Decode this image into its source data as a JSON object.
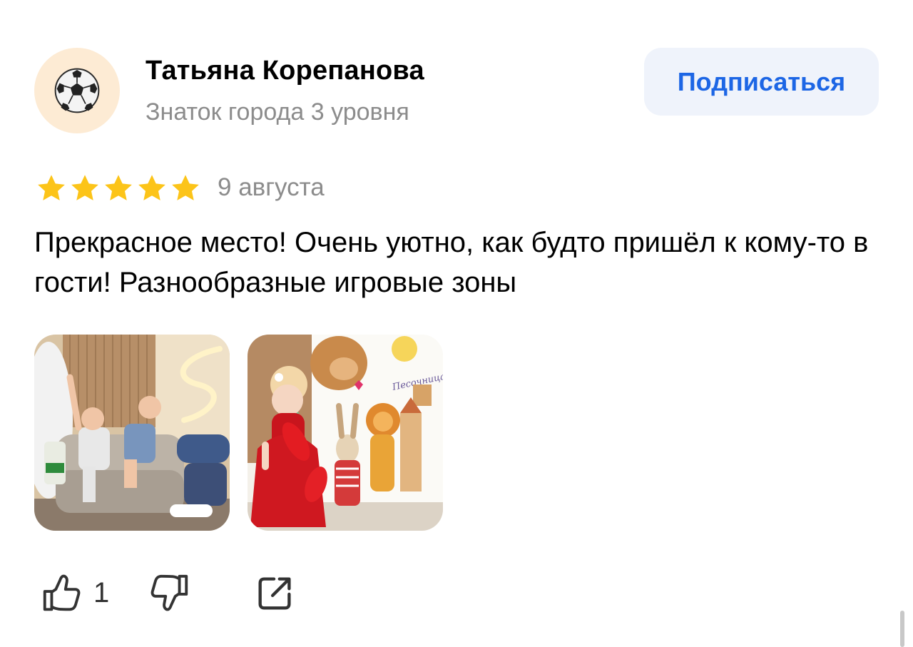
{
  "author": {
    "name": "Татьяна Корепанова",
    "level": "Знаток города 3 уровня",
    "avatar_icon": "soccer-ball-icon"
  },
  "subscribe": {
    "label": "Подписаться"
  },
  "review": {
    "rating": 5,
    "rating_max": 5,
    "date": "9 августа",
    "text": "Прекрасное место! Очень уютно, как будто пришёл к кому-то в гости! Разнообразные игровые зоны"
  },
  "photos": [
    {
      "icon": "photo-children-on-sofa"
    },
    {
      "icon": "photo-girl-red-dress-mural"
    }
  ],
  "photo_texts": [
    "Песочница"
  ],
  "actions": {
    "like_count": "1",
    "like_icon": "thumbs-up-icon",
    "dislike_icon": "thumbs-down-icon",
    "share_icon": "share-icon"
  },
  "colors": {
    "accent": "#1d66e5",
    "button_bg": "#eff3fb",
    "star": "#fcc419",
    "muted_text": "#8c8c8c",
    "avatar_bg": "#fdebd4"
  }
}
